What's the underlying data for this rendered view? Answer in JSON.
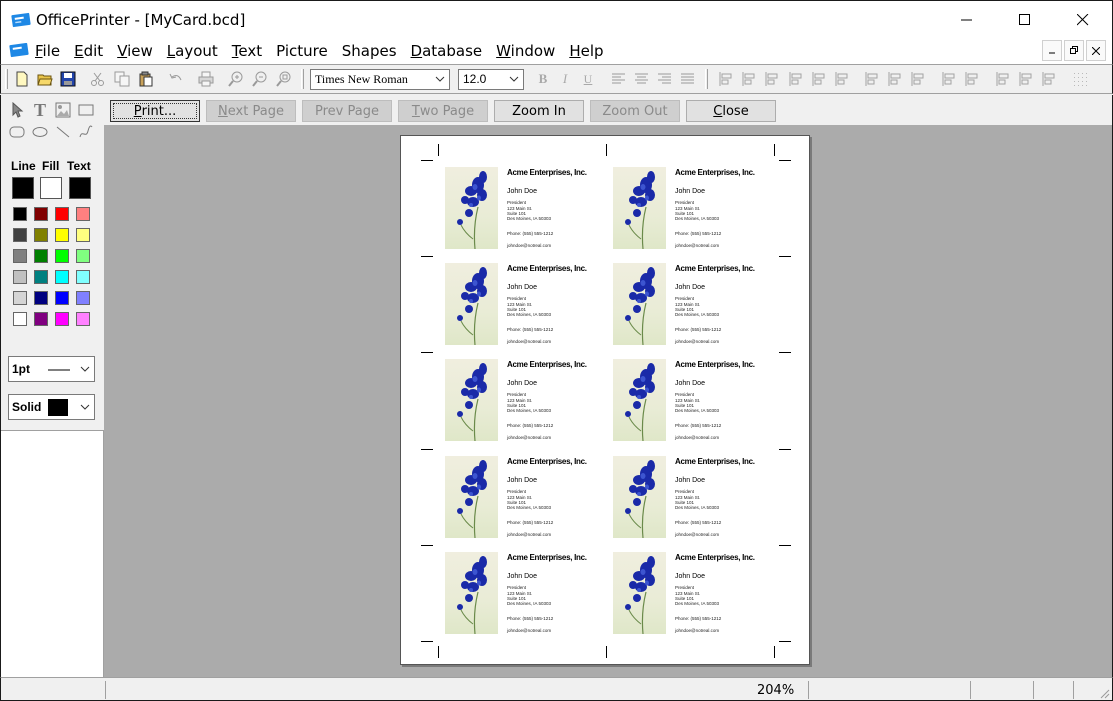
{
  "window": {
    "title": "OfficePrinter - [MyCard.bcd]",
    "minimize_icon": "minimize-icon",
    "maximize_icon": "maximize-icon",
    "close_icon": "close-icon"
  },
  "menu": {
    "items": [
      {
        "u": "F",
        "rest": "ile"
      },
      {
        "u": "E",
        "rest": "dit"
      },
      {
        "u": "V",
        "rest": "iew"
      },
      {
        "u": "L",
        "rest": "ayout"
      },
      {
        "u": "T",
        "rest": "ext"
      },
      {
        "u": "",
        "rest": "Picture"
      },
      {
        "u": "",
        "rest": "Shapes"
      },
      {
        "u": "D",
        "rest": "atabase"
      },
      {
        "u": "W",
        "rest": "indow"
      },
      {
        "u": "H",
        "rest": "elp"
      }
    ]
  },
  "toolbar": {
    "font": "Times New Roman",
    "size": "12.0"
  },
  "left_panel": {
    "line_label": "Line",
    "fill_label": "Fill",
    "text_label": "Text",
    "line_color": "#000000",
    "fill_color": "#ffffff",
    "text_color": "#000000",
    "palette": [
      [
        "#000000",
        "#800000",
        "#ff0000",
        "#ff8080"
      ],
      [
        "#404040",
        "#808000",
        "#ffff00",
        "#ffff80"
      ],
      [
        "#808080",
        "#008000",
        "#00ff00",
        "#80ff80"
      ],
      [
        "#c0c0c0",
        "#008080",
        "#00ffff",
        "#80ffff"
      ],
      [
        "#d4d4d4",
        "#000080",
        "#0000ff",
        "#8080ff"
      ],
      [
        "#ffffff",
        "#800080",
        "#ff00ff",
        "#ff80ff"
      ]
    ],
    "line_width": "1pt",
    "fill_style": "Solid"
  },
  "preview": {
    "buttons": [
      {
        "u": "",
        "pre": "",
        "label": "Print...",
        "focus": true,
        "disabled": false,
        "ul": "P",
        "rest": "rint..."
      },
      {
        "ul": "N",
        "rest": "ext Page",
        "disabled": true
      },
      {
        "ul": "",
        "rest": "Prev Page",
        "prevu": "v",
        "disabled": true
      },
      {
        "ul": "T",
        "rest": "wo Page",
        "disabled": true
      },
      {
        "ul": "",
        "rest": "Zoom In",
        "disabled": false
      },
      {
        "ul": "",
        "rest": "Zoom Out",
        "disabled": true
      },
      {
        "ul": "C",
        "rest": "lose",
        "disabled": false
      }
    ]
  },
  "card": {
    "company": "Acme Enterprises, Inc.",
    "name": "John Doe",
    "title": "President",
    "address1": "123 Main St.",
    "address2": "Suite 101",
    "address3": "Des Moines, IA 50303",
    "phone": "Phone: (555) 555-1212",
    "email": "johndoe@notreal.com"
  },
  "status": {
    "zoom": "204%"
  }
}
